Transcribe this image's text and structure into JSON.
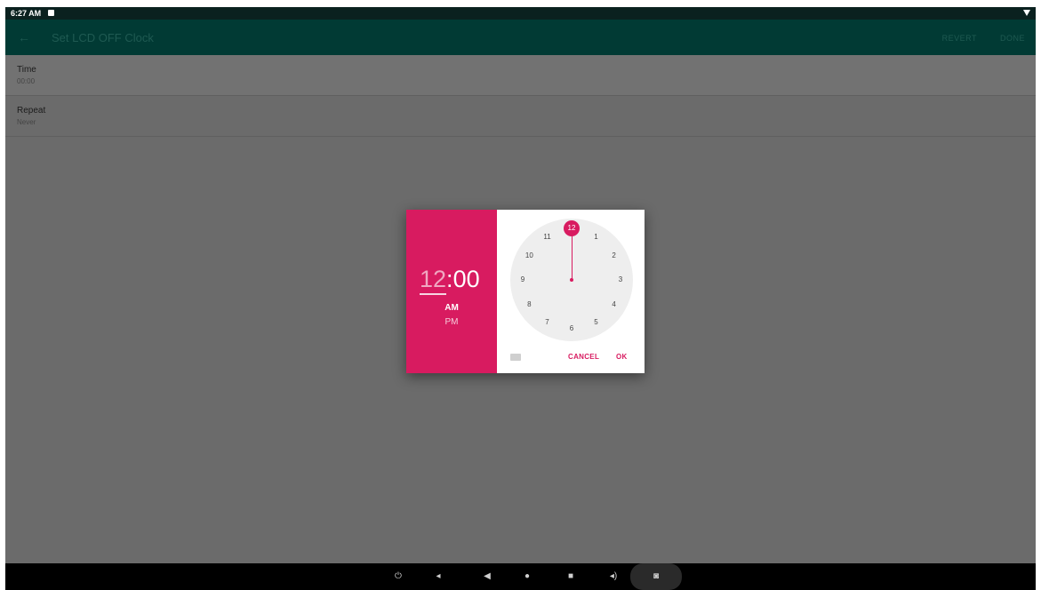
{
  "status_bar": {
    "time": "6:27 AM"
  },
  "app_bar": {
    "back_glyph": "←",
    "title": "Set LCD OFF Clock",
    "revert_label": "REVERT",
    "done_label": "DONE"
  },
  "settings": {
    "time": {
      "label": "Time",
      "value": "00:00"
    },
    "repeat": {
      "label": "Repeat",
      "value": "Never"
    }
  },
  "time_picker": {
    "hour": "12",
    "separator": ":",
    "minute": "00",
    "am_label": "AM",
    "pm_label": "PM",
    "selected_period": "AM",
    "selected_hour": "12",
    "clock_numbers": [
      "12",
      "1",
      "2",
      "3",
      "4",
      "5",
      "6",
      "7",
      "8",
      "9",
      "10",
      "11"
    ],
    "cancel_label": "CANCEL",
    "ok_label": "OK",
    "accent_color": "#d81b60",
    "keyboard_icon": "keyboard-icon"
  },
  "nav_bar": {
    "icons": [
      "power-icon",
      "volume-down-icon",
      "back-icon",
      "home-icon",
      "recents-icon",
      "volume-up-icon",
      "screenshot-icon"
    ],
    "power_glyph": "⏻",
    "volume_down_glyph": "◂",
    "back_glyph": "◀",
    "home_glyph": "●",
    "recents_glyph": "■",
    "volume_up_glyph": "◂)",
    "screenshot_glyph": "◙"
  }
}
